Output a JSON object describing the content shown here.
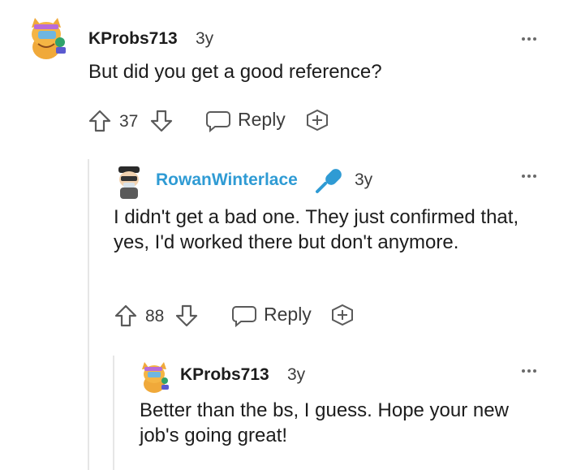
{
  "comments": [
    {
      "username": "KProbs713",
      "age": "3y",
      "text": "But did you get a good reference?",
      "votes": "37",
      "reply_label": "Reply"
    },
    {
      "username": "RowanWinterlace",
      "age": "3y",
      "text": "I didn't get a bad one. They just confirmed that, yes, I'd worked there but don't anymore.",
      "votes": "88",
      "reply_label": "Reply"
    },
    {
      "username": "KProbs713",
      "age": "3y",
      "text": "Better than the bs, I guess. Hope your new job's going great!"
    }
  ],
  "icons": {
    "upvote": "upvote-arrow-icon",
    "downvote": "downvote-arrow-icon",
    "reply": "speech-bubble-icon",
    "award": "award-plus-icon",
    "more": "more-options-icon",
    "op_badge": "microphone-icon"
  },
  "colors": {
    "op_username": "#2f9bd4",
    "text": "#1c1c1c",
    "muted": "#3c3c3c",
    "thread_line": "#e6e6e6"
  }
}
